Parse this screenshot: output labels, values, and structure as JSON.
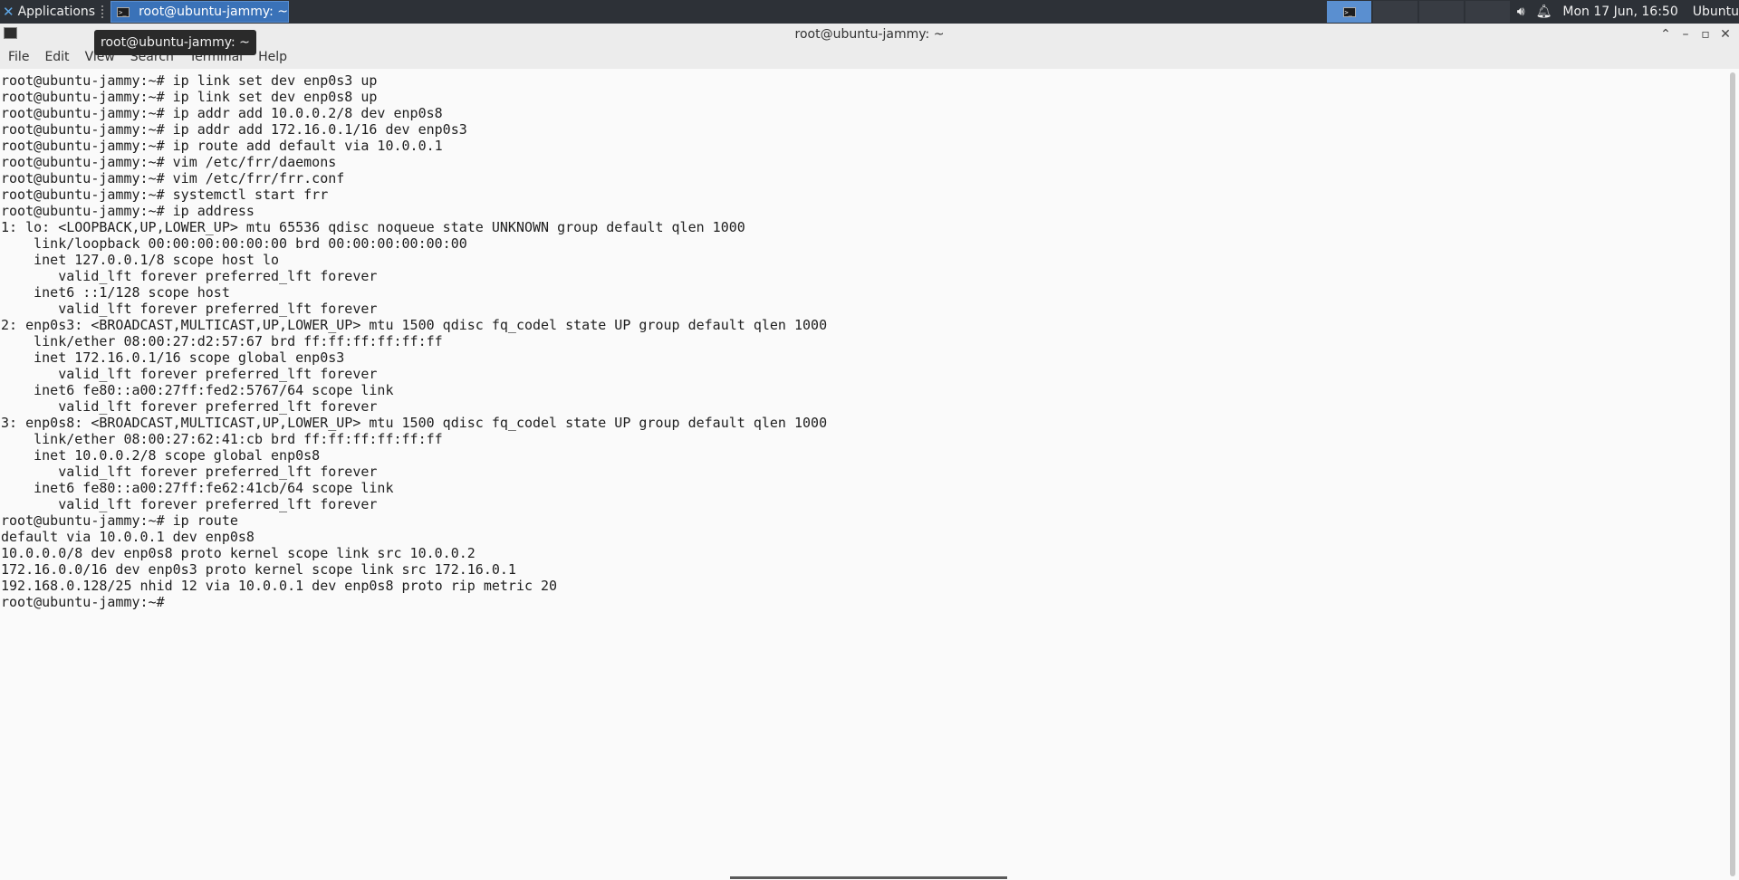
{
  "top_panel": {
    "apps_label": "Applications",
    "task_title": "root@ubuntu-jammy: ~",
    "clock": "Mon 17 Jun, 16:50",
    "user": "Ubuntu",
    "icons": [
      "volume-icon",
      "notification-bell-icon"
    ]
  },
  "tooltip": {
    "text": "root@ubuntu-jammy: ~"
  },
  "window": {
    "title": "root@ubuntu-jammy: ~"
  },
  "menubar": {
    "items": [
      "File",
      "Edit",
      "View",
      "Search",
      "Terminal",
      "Help"
    ]
  },
  "terminal": {
    "lines": [
      "root@ubuntu-jammy:~# ip link set dev enp0s3 up",
      "root@ubuntu-jammy:~# ip link set dev enp0s8 up",
      "root@ubuntu-jammy:~# ip addr add 10.0.0.2/8 dev enp0s8",
      "root@ubuntu-jammy:~# ip addr add 172.16.0.1/16 dev enp0s3",
      "root@ubuntu-jammy:~# ip route add default via 10.0.0.1",
      "root@ubuntu-jammy:~# vim /etc/frr/daemons",
      "root@ubuntu-jammy:~# vim /etc/frr/frr.conf",
      "root@ubuntu-jammy:~# systemctl start frr",
      "root@ubuntu-jammy:~# ip address",
      "1: lo: <LOOPBACK,UP,LOWER_UP> mtu 65536 qdisc noqueue state UNKNOWN group default qlen 1000",
      "    link/loopback 00:00:00:00:00:00 brd 00:00:00:00:00:00",
      "    inet 127.0.0.1/8 scope host lo",
      "       valid_lft forever preferred_lft forever",
      "    inet6 ::1/128 scope host",
      "       valid_lft forever preferred_lft forever",
      "2: enp0s3: <BROADCAST,MULTICAST,UP,LOWER_UP> mtu 1500 qdisc fq_codel state UP group default qlen 1000",
      "    link/ether 08:00:27:d2:57:67 brd ff:ff:ff:ff:ff:ff",
      "    inet 172.16.0.1/16 scope global enp0s3",
      "       valid_lft forever preferred_lft forever",
      "    inet6 fe80::a00:27ff:fed2:5767/64 scope link",
      "       valid_lft forever preferred_lft forever",
      "3: enp0s8: <BROADCAST,MULTICAST,UP,LOWER_UP> mtu 1500 qdisc fq_codel state UP group default qlen 1000",
      "    link/ether 08:00:27:62:41:cb brd ff:ff:ff:ff:ff:ff",
      "    inet 10.0.0.2/8 scope global enp0s8",
      "       valid_lft forever preferred_lft forever",
      "    inet6 fe80::a00:27ff:fe62:41cb/64 scope link",
      "       valid_lft forever preferred_lft forever",
      "root@ubuntu-jammy:~# ip route",
      "default via 10.0.0.1 dev enp0s8",
      "10.0.0.0/8 dev enp0s8 proto kernel scope link src 10.0.0.2",
      "172.16.0.0/16 dev enp0s3 proto kernel scope link src 172.16.0.1",
      "192.168.0.128/25 nhid 12 via 10.0.0.1 dev enp0s8 proto rip metric 20",
      "root@ubuntu-jammy:~# "
    ]
  },
  "colors": {
    "panel_bg": "#2d3137",
    "task_active": "#3a72b8",
    "terminal_bg": "#fafafa",
    "terminal_fg": "#202020"
  }
}
